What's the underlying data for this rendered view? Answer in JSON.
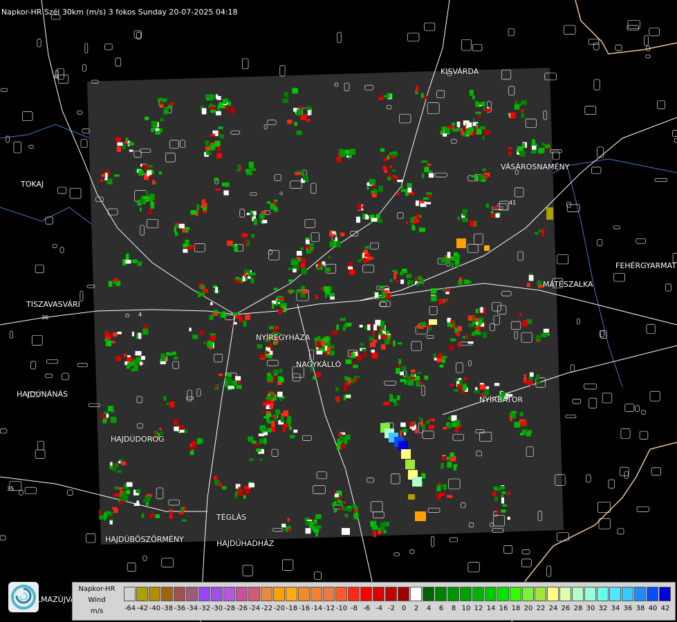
{
  "header": {
    "title": "Napkor-HR Szél 30km (m/s) 3 fokos Sunday 20-07-2025 04:18"
  },
  "map": {
    "background": "#000000",
    "radar_area_color": "#2e2e2e",
    "border_color": "#e8c89a",
    "river_color": "#4a78c8",
    "road_color": "#ffffff",
    "road_numbers": [
      "36",
      "41",
      "35",
      "4"
    ],
    "cities": [
      "KISVÁRDA",
      "TOKAJ",
      "VÁSÁROSNAMÉNY",
      "FEHÉRGYARMAT",
      "MÁTÉSZALKA",
      "TISZAVASVÁRI",
      "NYÍREGYHÁZA",
      "NAGYKÁLLÓ",
      "HAJDÚNÁNÁS",
      "NYÍRBÁTOR",
      "HAJDÚDOROG",
      "TÉGLÁS",
      "HAJDÚBÖSZÖRMÉNY",
      "HAJDÚHADHÁZ"
    ]
  },
  "brand": {
    "text": "LMAZÚJVÁR",
    "logo_icon": "spiral-logo-icon"
  },
  "legend": {
    "name": "Napkor-HR",
    "quantity": "Wind",
    "unit": "m/s",
    "ticks": [
      "-64",
      "-42",
      "-40",
      "-38",
      "-36",
      "-34",
      "-32",
      "-30",
      "-28",
      "-26",
      "-24",
      "-22",
      "-20",
      "-18",
      "-16",
      "-14",
      "-12",
      "-10",
      "-8",
      "-6",
      "-4",
      "-2",
      "0",
      "2",
      "4",
      "6",
      "8",
      "10",
      "12",
      "14",
      "16",
      "18",
      "20",
      "22",
      "24",
      "26",
      "28",
      "30",
      "32",
      "34",
      "36",
      "38",
      "40",
      "42"
    ],
    "colors": [
      "#d2d2d2",
      "#aaa000",
      "#b48c00",
      "#a06410",
      "#a05050",
      "#a05a78",
      "#9646ff",
      "#a050e6",
      "#b45adc",
      "#c8509c",
      "#d25a78",
      "#e68c3c",
      "#ffa000",
      "#ffaa14",
      "#f08c28",
      "#f08232",
      "#f07846",
      "#ff5a28",
      "#ff2814",
      "#ff0000",
      "#dc0000",
      "#be0000",
      "#a00000",
      "#ffffff",
      "#006400",
      "#008200",
      "#009600",
      "#00a000",
      "#00b400",
      "#00c800",
      "#00e600",
      "#32ff00",
      "#78f03c",
      "#a0e632",
      "#ffff82",
      "#dcffb4",
      "#b4ffc8",
      "#96ffdc",
      "#64ffe6",
      "#50e6ff",
      "#3cc8ff",
      "#1e8cff",
      "#0050ff",
      "#0000dc"
    ]
  }
}
